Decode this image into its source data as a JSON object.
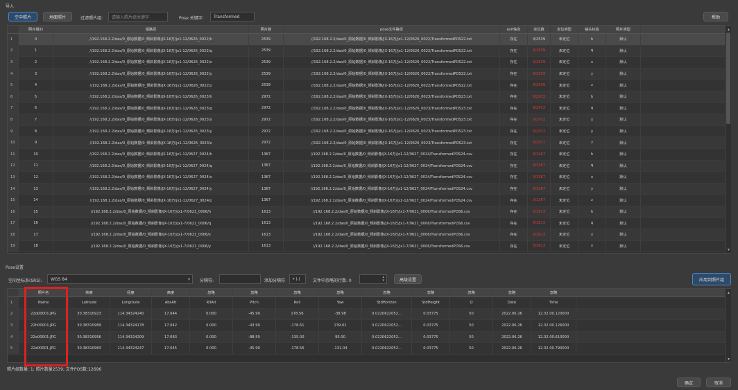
{
  "import_section": {
    "label": "导入"
  },
  "toolbar": {
    "empty_triangle_btn": "空中照片",
    "ground_photo_btn": "地面照片",
    "filter_label": "过滤照片组:",
    "filter_placeholder": "请输入照片组关键字",
    "pose_keyword_label": "Pose 关键字:",
    "pose_keyword_value": "Transformed",
    "help_btn": "帮助"
  },
  "photo_groups_table": {
    "headers": [
      "照片组ID",
      "组路径",
      "照片数",
      "pose文件路径",
      "exif信息",
      "定位数",
      "定位类型",
      "镜头标签",
      "照片类型"
    ],
    "rows": [
      {
        "n": "1",
        "id": "0",
        "path": "//192.168.2.2/das/0_原始数据/0_倾斜影像/JX-16万/jx1-12/0626_0022/h",
        "count": "2539",
        "pose": "//192.168.2.2/das/0_原始数据/0_倾斜影像/JX-16万/jx1-12/0626_0022/TransformedPOS22.txt",
        "exif": "存在",
        "loc": "0/2539",
        "loc_red": false,
        "loctype": "未定位",
        "lens": "h",
        "ptype": "默认"
      },
      {
        "n": "2",
        "id": "1",
        "path": "//192.168.2.2/das/0_原始数据/0_倾斜影像/JX-16万/jx1-12/0626_0022/q",
        "count": "2539",
        "pose": "//192.168.2.2/das/0_原始数据/0_倾斜影像/JX-16万/jx1-12/0626_0022/TransformedPOS22.txt",
        "exif": "存在",
        "loc": "0/2539",
        "loc_red": true,
        "loctype": "未定位",
        "lens": "q",
        "ptype": "默认"
      },
      {
        "n": "3",
        "id": "2",
        "path": "//192.168.2.2/das/0_原始数据/0_倾斜影像/JX-16万/jx1-12/0626_0022/x",
        "count": "2539",
        "pose": "//192.168.2.2/das/0_原始数据/0_倾斜影像/JX-16万/jx1-12/0626_0022/TransformedPOS22.txt",
        "exif": "存在",
        "loc": "0/2539",
        "loc_red": true,
        "loctype": "未定位",
        "lens": "x",
        "ptype": "默认"
      },
      {
        "n": "4",
        "id": "3",
        "path": "//192.168.2.2/das/0_原始数据/0_倾斜影像/JX-16万/jx1-12/0626_0022/y",
        "count": "2539",
        "pose": "//192.168.2.2/das/0_原始数据/0_倾斜影像/JX-16万/jx1-12/0626_0022/TransformedPOS22.txt",
        "exif": "存在",
        "loc": "0/2539",
        "loc_red": true,
        "loctype": "未定位",
        "lens": "y",
        "ptype": "默认"
      },
      {
        "n": "5",
        "id": "4",
        "path": "//192.168.2.2/das/0_原始数据/0_倾斜影像/JX-16万/jx1-12/0626_0022/z",
        "count": "2539",
        "pose": "//192.168.2.2/das/0_原始数据/0_倾斜影像/JX-16万/jx1-12/0626_0022/TransformedPOS22.txt",
        "exif": "存在",
        "loc": "0/2539",
        "loc_red": true,
        "loctype": "未定位",
        "lens": "z",
        "ptype": "默认"
      },
      {
        "n": "6",
        "id": "5",
        "path": "//192.168.2.2/das/0_原始数据/0_倾斜影像/JX-16万/jx1-12/0626_0023/h",
        "count": "2972",
        "pose": "//192.168.2.2/das/0_原始数据/0_倾斜影像/JX-16万/jx1-12/0626_0023/TransformedPOS23.txt",
        "exif": "存在",
        "loc": "0/2972",
        "loc_red": true,
        "loctype": "未定位",
        "lens": "h",
        "ptype": "默认"
      },
      {
        "n": "7",
        "id": "6",
        "path": "//192.168.2.2/das/0_原始数据/0_倾斜影像/JX-16万/jx1-12/0626_0023/q",
        "count": "2972",
        "pose": "//192.168.2.2/das/0_原始数据/0_倾斜影像/JX-16万/jx1-12/0626_0023/TransformedPOS23.txt",
        "exif": "存在",
        "loc": "0/2972",
        "loc_red": true,
        "loctype": "未定位",
        "lens": "q",
        "ptype": "默认"
      },
      {
        "n": "8",
        "id": "7",
        "path": "//192.168.2.2/das/0_原始数据/0_倾斜影像/JX-16万/jx1-12/0626_0023/x",
        "count": "2972",
        "pose": "//192.168.2.2/das/0_原始数据/0_倾斜影像/JX-16万/jx1-12/0626_0023/TransformedPOS23.txt",
        "exif": "存在",
        "loc": "0/2972",
        "loc_red": true,
        "loctype": "未定位",
        "lens": "x",
        "ptype": "默认"
      },
      {
        "n": "9",
        "id": "8",
        "path": "//192.168.2.2/das/0_原始数据/0_倾斜影像/JX-16万/jx1-12/0626_0023/y",
        "count": "2972",
        "pose": "//192.168.2.2/das/0_原始数据/0_倾斜影像/JX-16万/jx1-12/0626_0023/TransformedPOS23.txt",
        "exif": "存在",
        "loc": "0/2972",
        "loc_red": true,
        "loctype": "未定位",
        "lens": "y",
        "ptype": "默认"
      },
      {
        "n": "10",
        "id": "9",
        "path": "//192.168.2.2/das/0_原始数据/0_倾斜影像/JX-16万/jx1-12/0626_0023/z",
        "count": "2972",
        "pose": "//192.168.2.2/das/0_原始数据/0_倾斜影像/JX-16万/jx1-12/0626_0023/TransformedPOS23.txt",
        "exif": "存在",
        "loc": "0/2972",
        "loc_red": true,
        "loctype": "未定位",
        "lens": "z",
        "ptype": "默认"
      },
      {
        "n": "11",
        "id": "10",
        "path": "//192.168.2.2/das/0_原始数据/0_倾斜影像/JX-16万/jx1-12/0627_0024/h",
        "count": "1367",
        "pose": "//192.168.2.2/das/0_原始数据/0_倾斜影像/JX-16万/jx1-12/0627_0024/TransformedPOS24.csv",
        "exif": "存在",
        "loc": "0/1367",
        "loc_red": true,
        "loctype": "未定位",
        "lens": "h",
        "ptype": "默认"
      },
      {
        "n": "12",
        "id": "11",
        "path": "//192.168.2.2/das/0_原始数据/0_倾斜影像/JX-16万/jx1-12/0627_0024/q",
        "count": "1367",
        "pose": "//192.168.2.2/das/0_原始数据/0_倾斜影像/JX-16万/jx1-12/0627_0024/TransformedPOS24.csv",
        "exif": "存在",
        "loc": "0/1367",
        "loc_red": true,
        "loctype": "未定位",
        "lens": "q",
        "ptype": "默认"
      },
      {
        "n": "13",
        "id": "12",
        "path": "//192.168.2.2/das/0_原始数据/0_倾斜影像/JX-16万/jx1-12/0627_0024/x",
        "count": "1367",
        "pose": "//192.168.2.2/das/0_原始数据/0_倾斜影像/JX-16万/jx1-12/0627_0024/TransformedPOS24.csv",
        "exif": "存在",
        "loc": "0/1367",
        "loc_red": true,
        "loctype": "未定位",
        "lens": "x",
        "ptype": "默认"
      },
      {
        "n": "14",
        "id": "13",
        "path": "//192.168.2.2/das/0_原始数据/0_倾斜影像/JX-16万/jx1-12/0627_0024/y",
        "count": "1367",
        "pose": "//192.168.2.2/das/0_原始数据/0_倾斜影像/JX-16万/jx1-12/0627_0024/TransformedPOS24.csv",
        "exif": "存在",
        "loc": "0/1367",
        "loc_red": true,
        "loctype": "未定位",
        "lens": "y",
        "ptype": "默认"
      },
      {
        "n": "15",
        "id": "14",
        "path": "//192.168.2.2/das/0_原始数据/0_倾斜影像/JX-16万/jx1-12/0627_0024/z",
        "count": "1367",
        "pose": "//192.168.2.2/das/0_原始数据/0_倾斜影像/JX-16万/jx1-12/0627_0024/TransformedPOS24.csv",
        "exif": "存在",
        "loc": "0/1367",
        "loc_red": true,
        "loctype": "未定位",
        "lens": "z",
        "ptype": "默认"
      },
      {
        "n": "16",
        "id": "15",
        "path": "//192.168.2.2/das/0_原始数据/0_倾斜影像/JX-16万/jx1-7/0621_0006/h",
        "count": "1613",
        "pose": "//192.168.2.2/das/0_原始数据/0_倾斜影像/JX-16万/jx1-7/0621_0006/TransformedPOS6.csv",
        "exif": "存在",
        "loc": "0/1613",
        "loc_red": true,
        "loctype": "未定位",
        "lens": "h",
        "ptype": "默认"
      },
      {
        "n": "17",
        "id": "16",
        "path": "//192.168.2.2/das/0_原始数据/0_倾斜影像/JX-16万/jx1-7/0621_0006/q",
        "count": "1613",
        "pose": "//192.168.2.2/das/0_原始数据/0_倾斜影像/JX-16万/jx1-7/0621_0006/TransformedPOS6.csv",
        "exif": "存在",
        "loc": "0/1613",
        "loc_red": true,
        "loctype": "未定位",
        "lens": "q",
        "ptype": "默认"
      },
      {
        "n": "18",
        "id": "17",
        "path": "//192.168.2.2/das/0_原始数据/0_倾斜影像/JX-16万/jx1-7/0621_0006/x",
        "count": "1613",
        "pose": "//192.168.2.2/das/0_原始数据/0_倾斜影像/JX-16万/jx1-7/0621_0006/TransformedPOS6.csv",
        "exif": "存在",
        "loc": "0/1613",
        "loc_red": true,
        "loctype": "未定位",
        "lens": "x",
        "ptype": "默认"
      },
      {
        "n": "19",
        "id": "18",
        "path": "//192.168.2.2/das/0_原始数据/0_倾斜影像/JX-16万/jx1-7/0621_0006/y",
        "count": "1613",
        "pose": "//192.168.2.2/das/0_原始数据/0_倾斜影像/JX-16万/jx1-7/0621_0006/TransformedPOS6.csv",
        "exif": "存在",
        "loc": "0/1613",
        "loc_red": true,
        "loctype": "未定位",
        "lens": "y",
        "ptype": "默认"
      }
    ]
  },
  "pose_section": {
    "label": "Pose设置",
    "srs_label": "空间坐标系(SRS):",
    "srs_value": "WGS 84",
    "delimiter_label": "分隔符:",
    "add_delimiter_btn": "添加分隔符",
    "delimiter_symbol": "|,|",
    "ignore_rows_label": "文件中忽略的行数: 0",
    "advanced_btn": "高级设置",
    "apply_btn": "应用到照片组"
  },
  "pose_table": {
    "headers": [
      "照片名",
      "纬度",
      "经度",
      "高度",
      "忽略",
      "忽略",
      "忽略",
      "忽略",
      "忽略",
      "忽略",
      "忽略",
      "忽略",
      "忽略"
    ],
    "rows": [
      {
        "n": "1",
        "cells": [
          "Name",
          "Latitude",
          "Longitude",
          "AbsAlt",
          "RltAlt",
          "Pitch",
          "Roll",
          "Yaw",
          "StdHorizon",
          "StdHeight",
          "Q",
          "Date",
          "Time"
        ]
      },
      {
        "n": "2",
        "cells": [
          "22q00001.JPG",
          "30.38310923",
          "114.34324240",
          "17.044",
          "0.000",
          "-45.99",
          "178.56",
          "-38.98",
          "0.0220622052...",
          "0.03775",
          "50",
          "2022.06.26",
          "12.32.00.120000"
        ]
      },
      {
        "n": "3",
        "cells": [
          "22h00001.JPG",
          "30.38310989",
          "114.34324178",
          "17.042",
          "0.000",
          "-43.99",
          "-178.61",
          "139.02",
          "0.0220622052...",
          "0.03775",
          "50",
          "2022.06.26",
          "12.32.00.126000"
        ]
      },
      {
        "n": "4",
        "cells": [
          "22x00001.JPG",
          "30.38310956",
          "114.34324209",
          "17.083",
          "0.000",
          "-88.59",
          "-135.00",
          "95.00",
          "0.0220622052...",
          "0.03775",
          "50",
          "2022.06.26",
          "12.32.00.610000"
        ]
      },
      {
        "n": "5",
        "cells": [
          "22z00001.JPG",
          "30.38310983",
          "114.34324247",
          "17.045",
          "0.000",
          "-45.99",
          "-178.56",
          "-131.04",
          "0.0220622052...",
          "0.03775",
          "50",
          "2022.06.26",
          "12.32.00.790000"
        ]
      }
    ]
  },
  "status_bar": {
    "text": "照片组数量: 1; 照片数量2539; 文件POS数:12696"
  },
  "footer": {
    "ok_btn": "确定",
    "cancel_btn": "取消"
  }
}
